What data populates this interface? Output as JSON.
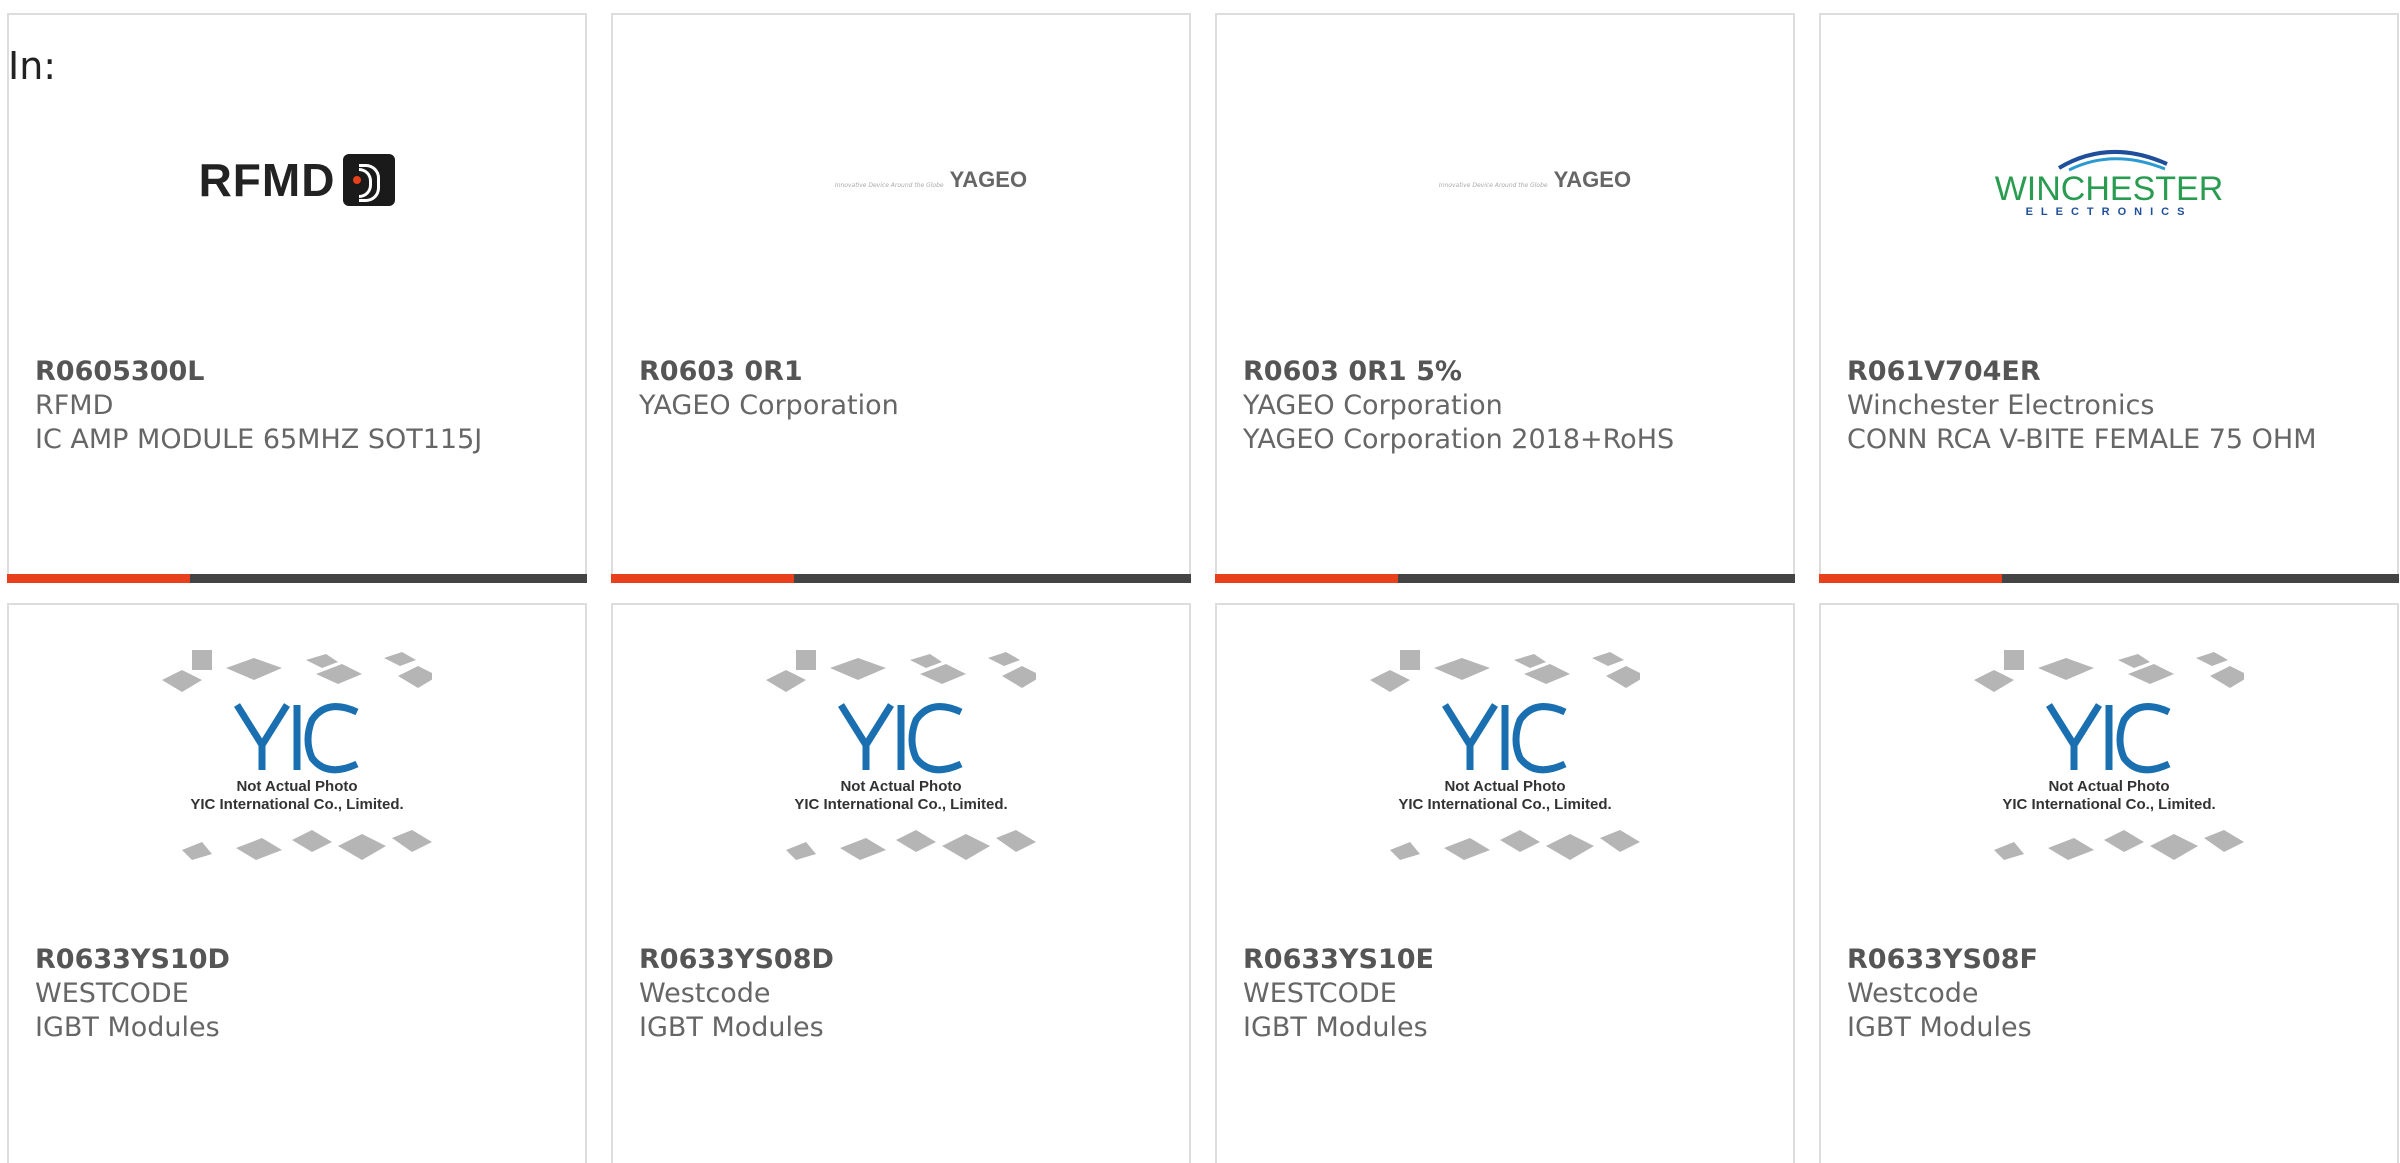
{
  "header": {
    "in_label": "In:"
  },
  "cards_row1": [
    {
      "part_number": "R0605300L",
      "manufacturer": "RFMD",
      "description": "IC AMP MODULE 65MHZ SOT115J",
      "logo": "rfmd-logo",
      "logo_text": "RFMD"
    },
    {
      "part_number": "R0603 0R1",
      "manufacturer": "YAGEO Corporation",
      "description": "",
      "logo": "yageo-logo",
      "logo_text": "YAGEO",
      "logo_tagline": "Innovative Device Around the Globe"
    },
    {
      "part_number": "R0603 0R1 5%",
      "manufacturer": "YAGEO Corporation",
      "description": "YAGEO Corporation 2018+RoHS",
      "logo": "yageo-logo",
      "logo_text": "YAGEO",
      "logo_tagline": "Innovative Device Around the Globe"
    },
    {
      "part_number": "R061V704ER",
      "manufacturer": "Winchester Electronics",
      "description": "CONN RCA V-BITE FEMALE 75 OHM",
      "logo": "winchester-logo",
      "logo_text": "WINCHESTER",
      "logo_sub": "ELECTRONICS"
    }
  ],
  "cards_row2": [
    {
      "part_number": "R0633YS10D",
      "manufacturer": "WESTCODE",
      "description": "IGBT Modules",
      "logo": "yic-placeholder"
    },
    {
      "part_number": "R0633YS08D",
      "manufacturer": "Westcode",
      "description": "IGBT Modules",
      "logo": "yic-placeholder"
    },
    {
      "part_number": "R0633YS10E",
      "manufacturer": "WESTCODE",
      "description": "IGBT Modules",
      "logo": "yic-placeholder"
    },
    {
      "part_number": "R0633YS08F",
      "manufacturer": "Westcode",
      "description": "IGBT Modules",
      "logo": "yic-placeholder"
    }
  ],
  "placeholder": {
    "line1": "Not Actual Photo",
    "line2": "YIC International Co., Limited."
  },
  "colors": {
    "accent": "#e8401c",
    "bar": "#444444",
    "border": "#dddddd",
    "text": "#666666"
  }
}
